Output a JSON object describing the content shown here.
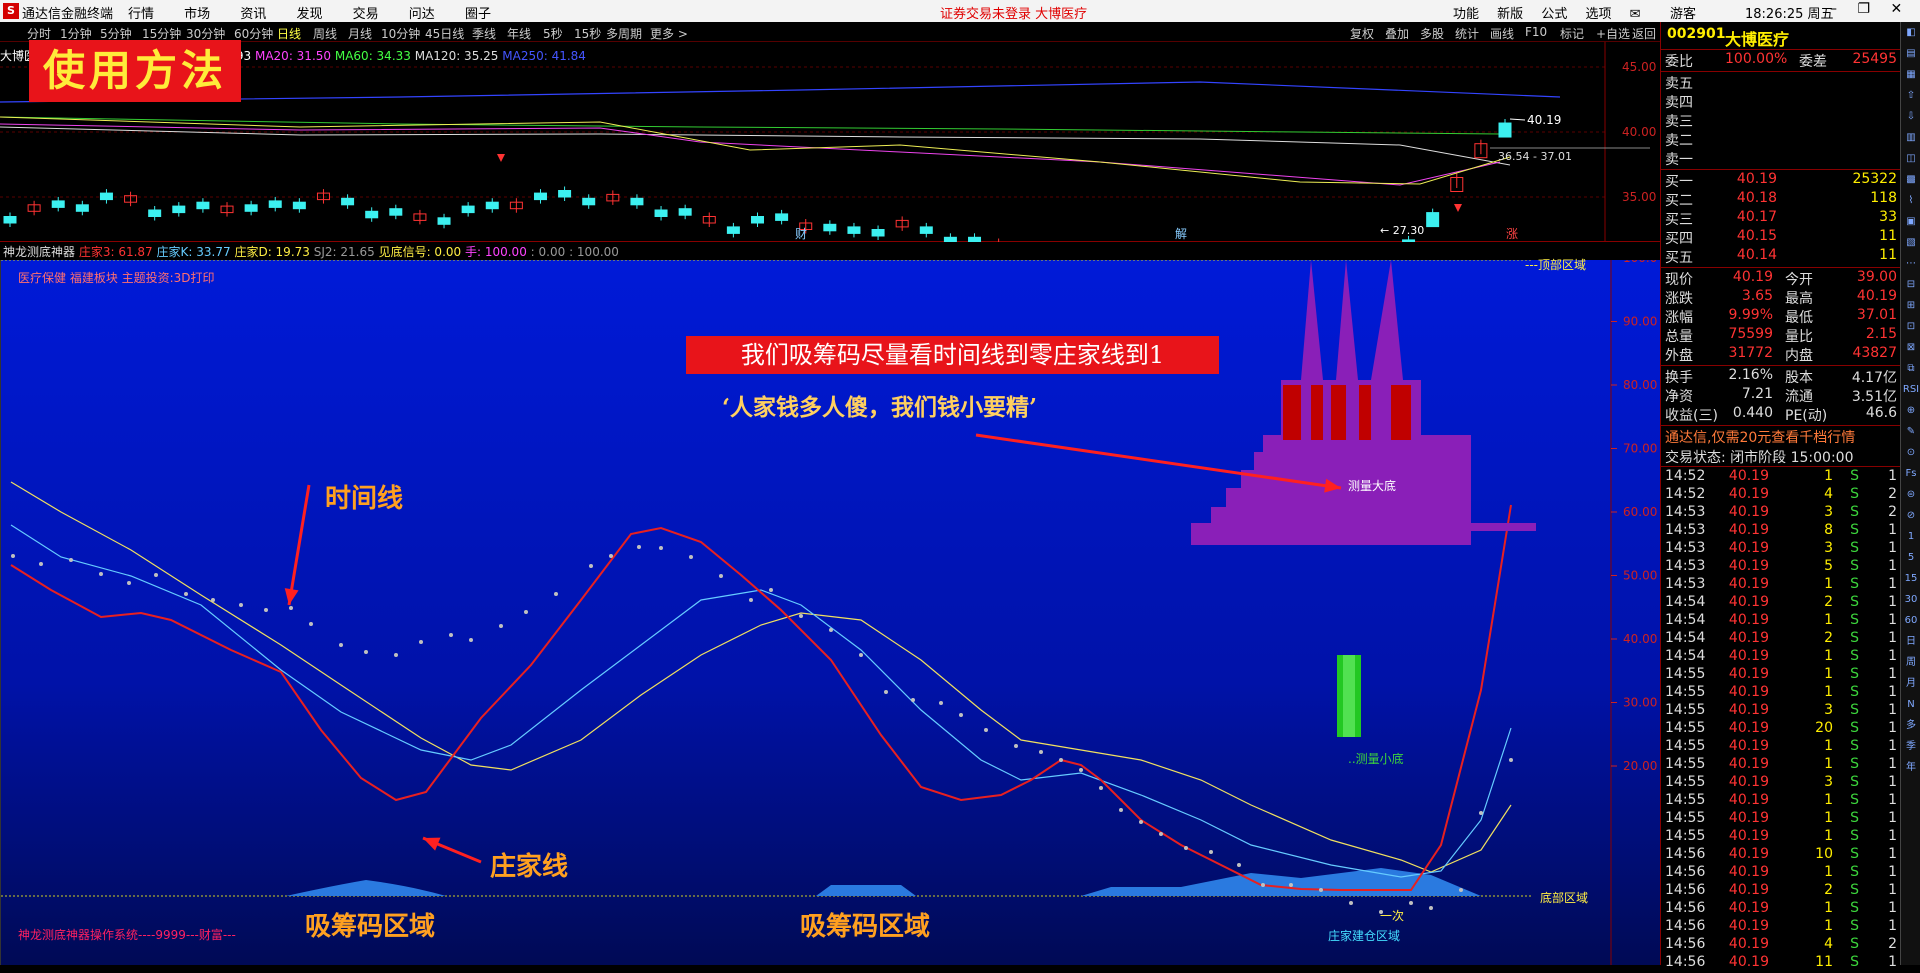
{
  "titlebar": {
    "app_title": "通达信金融终端",
    "menu": [
      "行情",
      "市场",
      "资讯",
      "发现",
      "交易",
      "问达",
      "圈子"
    ],
    "notice": "证券交易未登录  大博医疗",
    "right_items": [
      "功能",
      "新版",
      "公式",
      "选项"
    ],
    "guest": "游客",
    "clock": "18:26:25 周五"
  },
  "periods": [
    "分时",
    "1分钟",
    "5分钟",
    "15分钟",
    "30分钟",
    "60分钟",
    "日线",
    "周线",
    "月线",
    "10分钟",
    "45日线",
    "季线",
    "年线",
    "5秒",
    "15秒",
    "多周期",
    "更多 >"
  ],
  "active_period": "日线",
  "toolbar_right": [
    "复权",
    "叠加",
    "多股",
    "统计",
    "画线",
    "F10",
    "标记",
    "+自选",
    "返回"
  ],
  "kchart": {
    "stock_label": "大博医",
    "ma_items": [
      {
        "text": "10: 30.93",
        "color": "#ffffff"
      },
      {
        "text": "MA20: 31.50",
        "color": "#ff44ff"
      },
      {
        "text": "MA60: 34.33",
        "color": "#44ff44"
      },
      {
        "text": "MA120: 35.25",
        "color": "#dddddd"
      },
      {
        "text": "MA250: 41.84",
        "color": "#4455ff"
      }
    ],
    "price_ticks": [
      "45.00",
      "40.00",
      "35.00",
      "30.00"
    ],
    "high_label": "40.19",
    "range_label": "36.54 - 37.01",
    "low_label": "27.30",
    "markers": [
      "财",
      "解",
      "涨"
    ],
    "usage_banner": "使用方法"
  },
  "indicator": {
    "legend": [
      {
        "text": "神龙测底神器",
        "color": "#dddddd"
      },
      {
        "text": "庄家3: 61.87",
        "color": "#ff3333"
      },
      {
        "text": "庄家K: 33.77",
        "color": "#66ccff"
      },
      {
        "text": "庄家D: 19.73",
        "color": "#ffee44"
      },
      {
        "text": "SJ2: 21.65",
        "color": "#999999"
      },
      {
        "text": "见底信号: 0.00",
        "color": "#ffee44"
      },
      {
        "text": "手: 100.00",
        "color": "#ff44ff"
      },
      {
        "text": ": 0.00 : 100.00",
        "color": "#999999"
      }
    ],
    "sector_text": "医疗保健 福建板块 主题投资:3D打印",
    "top_zone": "---顶部区域",
    "bottom_zone": "底部区域",
    "y_ticks": [
      "100.0",
      "90.00",
      "80.00",
      "70.00",
      "60.00",
      "50.00",
      "40.00",
      "30.00",
      "20.00"
    ],
    "measure_big": "测量大底",
    "measure_small": "..测量小底",
    "yici": "一次",
    "zhuangjia_area": "庄家建仓区域",
    "system_name": "神龙测底神器操作系统----9999---财富---",
    "annotations": {
      "time_line": "时间线",
      "dealer_line": "庄家线",
      "absorb_zone_1": "吸筹码区域",
      "absorb_zone_2": "吸筹码区域",
      "banner": "我们吸筹码尽量看时间线到零庄家线到1",
      "quote": "‘人家钱多人傻，我们钱小要精’"
    }
  },
  "quote_panel": {
    "code": "002901",
    "name": "大博医疗",
    "weibi_label": "委比",
    "weibi_value": "100.00%",
    "weicha_label": "委差",
    "weicha_value": "25495",
    "sell_levels": [
      "卖五",
      "卖四",
      "卖三",
      "卖二",
      "卖一"
    ],
    "buy_levels": [
      {
        "label": "买一",
        "price": "40.19",
        "vol": "25322"
      },
      {
        "label": "买二",
        "price": "40.18",
        "vol": "118"
      },
      {
        "label": "买三",
        "price": "40.17",
        "vol": "33"
      },
      {
        "label": "买四",
        "price": "40.15",
        "vol": "11"
      },
      {
        "label": "买五",
        "price": "40.14",
        "vol": "11"
      }
    ],
    "stats": [
      {
        "l1": "现价",
        "v1": "40.19",
        "l2": "今开",
        "v2": "39.00"
      },
      {
        "l1": "涨跌",
        "v1": "3.65",
        "l2": "最高",
        "v2": "40.19"
      },
      {
        "l1": "涨幅",
        "v1": "9.99%",
        "l2": "最低",
        "v2": "37.01"
      },
      {
        "l1": "总量",
        "v1": "75599",
        "l2": "量比",
        "v2": "2.15"
      },
      {
        "l1": "外盘",
        "v1": "31772",
        "l2": "内盘",
        "v2": "43827"
      }
    ],
    "stats2": [
      {
        "l1": "换手",
        "v1": "2.16%",
        "l2": "股本",
        "v2": "4.17亿"
      },
      {
        "l1": "净资",
        "v1": "7.21",
        "l2": "流通",
        "v2": "3.51亿"
      },
      {
        "l1": "收益(三)",
        "v1": "0.440",
        "l2": "PE(动)",
        "v2": "46.6"
      }
    ],
    "promo": "通达信,仅需20元查看千档行情",
    "trade_state": "交易状态: 闭市阶段 15:00:00",
    "ticks": [
      {
        "t": "14:52",
        "p": "40.19",
        "v": "1",
        "s": "S",
        "n": "1"
      },
      {
        "t": "14:52",
        "p": "40.19",
        "v": "4",
        "s": "S",
        "n": "2"
      },
      {
        "t": "14:53",
        "p": "40.19",
        "v": "3",
        "s": "S",
        "n": "2"
      },
      {
        "t": "14:53",
        "p": "40.19",
        "v": "8",
        "s": "S",
        "n": "1"
      },
      {
        "t": "14:53",
        "p": "40.19",
        "v": "3",
        "s": "S",
        "n": "1"
      },
      {
        "t": "14:53",
        "p": "40.19",
        "v": "5",
        "s": "S",
        "n": "1"
      },
      {
        "t": "14:53",
        "p": "40.19",
        "v": "1",
        "s": "S",
        "n": "1"
      },
      {
        "t": "14:54",
        "p": "40.19",
        "v": "2",
        "s": "S",
        "n": "1"
      },
      {
        "t": "14:54",
        "p": "40.19",
        "v": "1",
        "s": "S",
        "n": "1"
      },
      {
        "t": "14:54",
        "p": "40.19",
        "v": "2",
        "s": "S",
        "n": "1"
      },
      {
        "t": "14:54",
        "p": "40.19",
        "v": "1",
        "s": "S",
        "n": "1"
      },
      {
        "t": "14:55",
        "p": "40.19",
        "v": "1",
        "s": "S",
        "n": "1"
      },
      {
        "t": "14:55",
        "p": "40.19",
        "v": "1",
        "s": "S",
        "n": "1"
      },
      {
        "t": "14:55",
        "p": "40.19",
        "v": "3",
        "s": "S",
        "n": "1"
      },
      {
        "t": "14:55",
        "p": "40.19",
        "v": "20",
        "s": "S",
        "n": "1"
      },
      {
        "t": "14:55",
        "p": "40.19",
        "v": "1",
        "s": "S",
        "n": "1"
      },
      {
        "t": "14:55",
        "p": "40.19",
        "v": "1",
        "s": "S",
        "n": "1"
      },
      {
        "t": "14:55",
        "p": "40.19",
        "v": "3",
        "s": "S",
        "n": "1"
      },
      {
        "t": "14:55",
        "p": "40.19",
        "v": "1",
        "s": "S",
        "n": "1"
      },
      {
        "t": "14:55",
        "p": "40.19",
        "v": "1",
        "s": "S",
        "n": "1"
      },
      {
        "t": "14:55",
        "p": "40.19",
        "v": "1",
        "s": "S",
        "n": "1"
      },
      {
        "t": "14:56",
        "p": "40.19",
        "v": "10",
        "s": "S",
        "n": "1"
      },
      {
        "t": "14:56",
        "p": "40.19",
        "v": "1",
        "s": "S",
        "n": "1"
      },
      {
        "t": "14:56",
        "p": "40.19",
        "v": "2",
        "s": "S",
        "n": "1"
      },
      {
        "t": "14:56",
        "p": "40.19",
        "v": "1",
        "s": "S",
        "n": "1"
      },
      {
        "t": "14:56",
        "p": "40.19",
        "v": "1",
        "s": "S",
        "n": "1"
      },
      {
        "t": "14:56",
        "p": "40.19",
        "v": "4",
        "s": "S",
        "n": "2"
      },
      {
        "t": "14:56",
        "p": "40.19",
        "v": "11",
        "s": "S",
        "n": "1"
      }
    ]
  },
  "toolbar_icons": [
    "日",
    "周",
    "月",
    "N",
    "多",
    "季",
    "年"
  ],
  "colors": {
    "up": "#ff3333",
    "down": "#3cf0f0",
    "dealer": "#e82020",
    "time": "#f0e060",
    "k": "#66ccff"
  }
}
